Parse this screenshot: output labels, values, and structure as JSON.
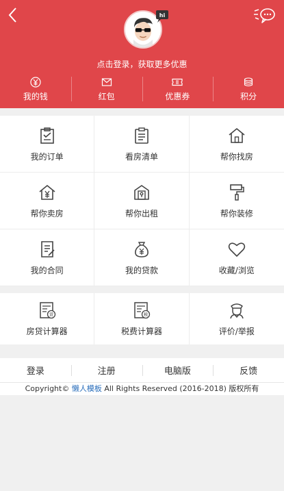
{
  "header": {
    "back_icon": "back-arrow-icon",
    "message_icon": "chat-bubble-icon",
    "avatar_badge": "hi",
    "login_tip": "点击登录，获取更多优惠",
    "stats": [
      {
        "label": "我的钱",
        "icon": "yen-coin-icon"
      },
      {
        "label": "红包",
        "icon": "red-envelope-icon"
      },
      {
        "label": "优惠券",
        "icon": "coupon-icon"
      },
      {
        "label": "积分",
        "icon": "points-stack-icon"
      }
    ]
  },
  "menu": [
    {
      "label": "我的订单",
      "icon": "order-clipboard-icon"
    },
    {
      "label": "看房清单",
      "icon": "list-clipboard-icon"
    },
    {
      "label": "帮你找房",
      "icon": "house-icon"
    },
    {
      "label": "帮你卖房",
      "icon": "house-yen-icon"
    },
    {
      "label": "帮你出租",
      "icon": "house-key-icon"
    },
    {
      "label": "帮你装修",
      "icon": "paint-roller-icon"
    },
    {
      "label": "我的合同",
      "icon": "contract-icon"
    },
    {
      "label": "我的贷款",
      "icon": "money-bag-icon"
    },
    {
      "label": "收藏/浏览",
      "icon": "heart-icon"
    }
  ],
  "tools": [
    {
      "label": "房贷计算器",
      "icon": "loan-calculator-icon",
      "badge": "贷"
    },
    {
      "label": "税费计算器",
      "icon": "tax-calculator-icon",
      "badge": "税"
    },
    {
      "label": "评价/举报",
      "icon": "officer-icon"
    }
  ],
  "footer": {
    "nav": [
      "登录",
      "注册",
      "电脑版",
      "反馈"
    ],
    "copyright_prefix": "Copyright© ",
    "copyright_link": "懒人模板",
    "copyright_suffix": " All Rights Reserved (2016-2018) 版权所有"
  },
  "colors": {
    "brand": "#e0464a",
    "link": "#2a6ebb",
    "background": "#f0f0f0"
  }
}
